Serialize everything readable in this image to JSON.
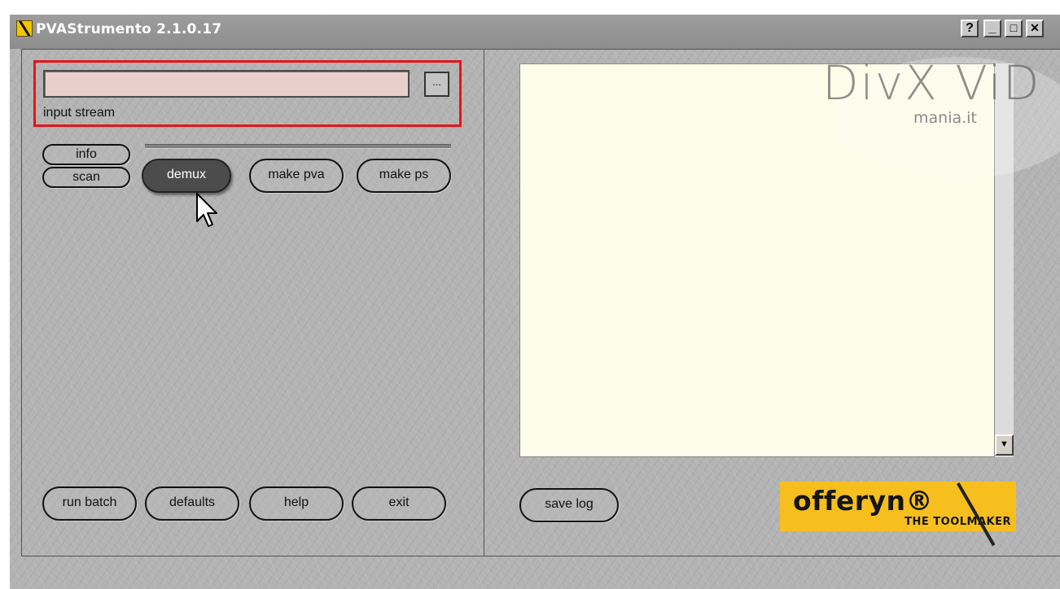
{
  "window": {
    "title": "PVAStrumento 2.1.0.17",
    "help_btn": "?",
    "minimize_btn": "_",
    "maximize_btn": "□",
    "close_btn": "✕"
  },
  "input": {
    "value": "",
    "label": "input stream",
    "browse_label": "..."
  },
  "buttons": {
    "info": "info",
    "scan": "scan",
    "demux": "demux",
    "make_pva": "make pva",
    "make_ps": "make ps",
    "run_batch": "run batch",
    "defaults": "defaults",
    "help": "help",
    "exit": "exit",
    "save_log": "save log"
  },
  "log": {
    "scroll_down": "▼"
  },
  "logo": {
    "name": "offeryn®",
    "tagline": "THE TOOLMAKER"
  },
  "watermark": {
    "brand": "DivX ViD",
    "sub": "mania.it"
  },
  "colors": {
    "input_highlight": "#e8131a",
    "active_button": "#4c4c4c",
    "log_background": "#fdfde9",
    "logo_background": "#f6bf1e"
  },
  "state": {
    "active_button": "demux"
  }
}
